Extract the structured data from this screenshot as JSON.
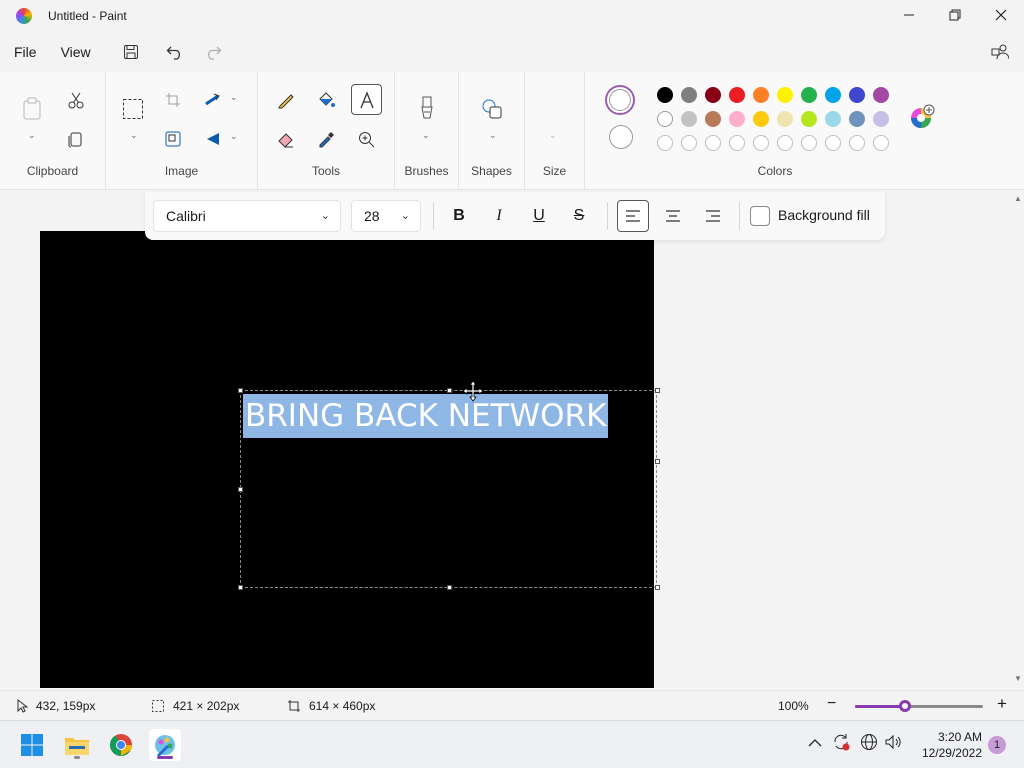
{
  "window": {
    "title": "Untitled - Paint"
  },
  "menu": {
    "file": "File",
    "view": "View"
  },
  "ribbon": {
    "groups": {
      "clipboard": "Clipboard",
      "image": "Image",
      "tools": "Tools",
      "brushes": "Brushes",
      "shapes": "Shapes",
      "size": "Size",
      "colors": "Colors"
    },
    "palette_row1": [
      "#000000",
      "#7f7f7f",
      "#880015",
      "#ed1c24",
      "#ff7f27",
      "#fff200",
      "#22b14c",
      "#00a2e8",
      "#3f48cc",
      "#a349a4"
    ],
    "palette_row2": [
      "#ffffff",
      "#c3c3c3",
      "#b97a57",
      "#ffaec9",
      "#ffc90e",
      "#efe4b0",
      "#b5e61d",
      "#99d9ea",
      "#7092be",
      "#c8bfe7"
    ],
    "custom_row_count": 10
  },
  "text_toolbar": {
    "font": "Calibri",
    "size": "28",
    "bold": "B",
    "italic": "I",
    "underline": "U",
    "strike": "S",
    "background_fill": "Background fill"
  },
  "canvas": {
    "text": "BRING BACK NETWORK",
    "background": "#000000",
    "text_highlight": "#8fb7e6"
  },
  "status": {
    "cursor_pos": "432, 159px",
    "selection_size": "421 × 202px",
    "canvas_size": "614 × 460px",
    "zoom": "100%",
    "zoom_level": 0.39
  },
  "taskbar": {
    "time": "3:20 AM",
    "date": "12/29/2022",
    "notifications": "1"
  }
}
